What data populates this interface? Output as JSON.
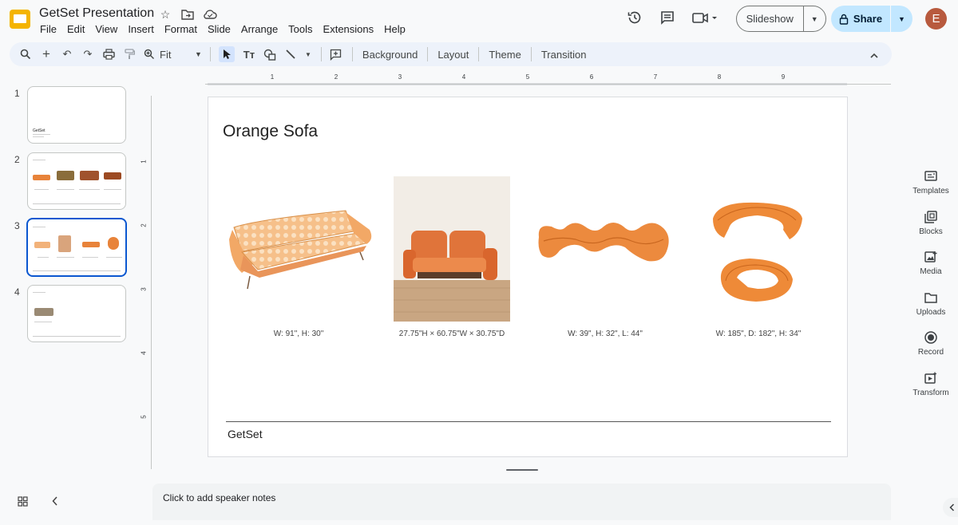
{
  "app": {
    "title": "GetSet Presentation",
    "menu": [
      "File",
      "Edit",
      "View",
      "Insert",
      "Format",
      "Slide",
      "Arrange",
      "Tools",
      "Extensions",
      "Help"
    ],
    "slideshow_label": "Slideshow",
    "share_label": "Share",
    "avatar_initial": "E",
    "brand_color": "#f4b400",
    "share_color": "#c2e7ff",
    "accent": "#0b57d0"
  },
  "toolbar": {
    "zoom_value": "Fit",
    "background_label": "Background",
    "layout_label": "Layout",
    "theme_label": "Theme",
    "transition_label": "Transition"
  },
  "ruler": {
    "horizontal": [
      "1",
      "2",
      "3",
      "4",
      "5",
      "6",
      "7",
      "8",
      "9"
    ],
    "vertical": [
      "1",
      "2",
      "3",
      "4",
      "5"
    ]
  },
  "filmstrip": {
    "numbers": [
      "1",
      "2",
      "3",
      "4"
    ],
    "active_slide": 3,
    "slide1_title": "GetSet"
  },
  "slide": {
    "title": "Orange Sofa",
    "captions": [
      "W: 91\", H: 30\"",
      "27.75\"H × 60.75\"W × 30.75\"D",
      "W: 39\", H: 32\", L: 44\"",
      "W: 185\", D: 182\", H: 34\""
    ],
    "footer": "GetSet"
  },
  "notes": {
    "placeholder": "Click to add speaker notes"
  },
  "side_panel": [
    "Templates",
    "Blocks",
    "Media",
    "Uploads",
    "Record",
    "Transform"
  ]
}
